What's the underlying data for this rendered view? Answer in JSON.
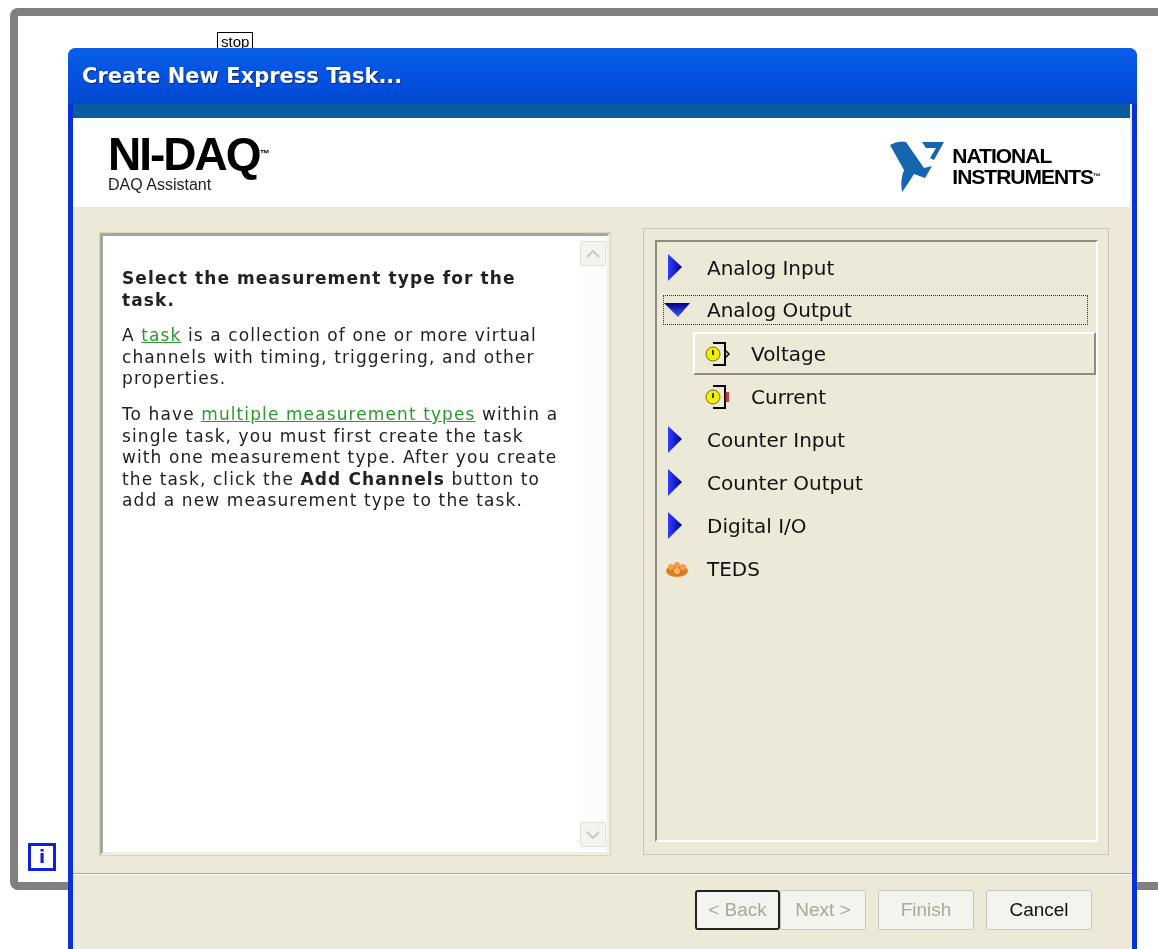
{
  "canvas": {
    "stop_label": "stop",
    "iteration_terminal": "i"
  },
  "dialog": {
    "title": "Create New Express Task...",
    "header": {
      "product": "NI-DAQ",
      "product_mark": "™",
      "subtitle": "DAQ Assistant",
      "brand_lines": [
        "NATIONAL",
        "INSTRUMENTS"
      ],
      "brand_mark": "™"
    },
    "help": {
      "heading": "Select the measurement type for the task.",
      "paragraphs": [
        [
          {
            "kind": "text",
            "text": "A "
          },
          {
            "kind": "link",
            "text": "task"
          },
          {
            "kind": "text",
            "text": " is a collection of one or more virtual channels with timing, triggering, and other properties."
          }
        ],
        [
          {
            "kind": "text",
            "text": "To have "
          },
          {
            "kind": "link",
            "text": "multiple measurement types"
          },
          {
            "kind": "text",
            "text": " within a single task, you must first create the task with one measurement type. After you create the task, click the **Add Channels** button to add a new measurement type to the task."
          }
        ]
      ]
    },
    "tree": [
      {
        "kind": "category",
        "label": "Analog Input",
        "expanded": false,
        "focused": false,
        "selected": false
      },
      {
        "kind": "category",
        "label": "Analog Output",
        "expanded": true,
        "focused": true,
        "selected": false,
        "children": [
          {
            "kind": "voltage",
            "label": "Voltage",
            "selected": true
          },
          {
            "kind": "current",
            "label": "Current",
            "selected": false
          }
        ]
      },
      {
        "kind": "category",
        "label": "Counter Input",
        "expanded": false,
        "focused": false,
        "selected": false
      },
      {
        "kind": "category",
        "label": "Counter Output",
        "expanded": false,
        "focused": false,
        "selected": false
      },
      {
        "kind": "category",
        "label": "Digital I/O",
        "expanded": false,
        "focused": false,
        "selected": false
      },
      {
        "kind": "teds",
        "label": "TEDS",
        "focused": false,
        "selected": false
      }
    ],
    "buttons": [
      {
        "label": "< Back",
        "disabled": true,
        "default": true
      },
      {
        "label": "Next >",
        "disabled": true,
        "default": false
      },
      {
        "label": "Finish",
        "disabled": true,
        "default": false
      },
      {
        "label": "Cancel",
        "disabled": false,
        "default": false
      }
    ]
  }
}
